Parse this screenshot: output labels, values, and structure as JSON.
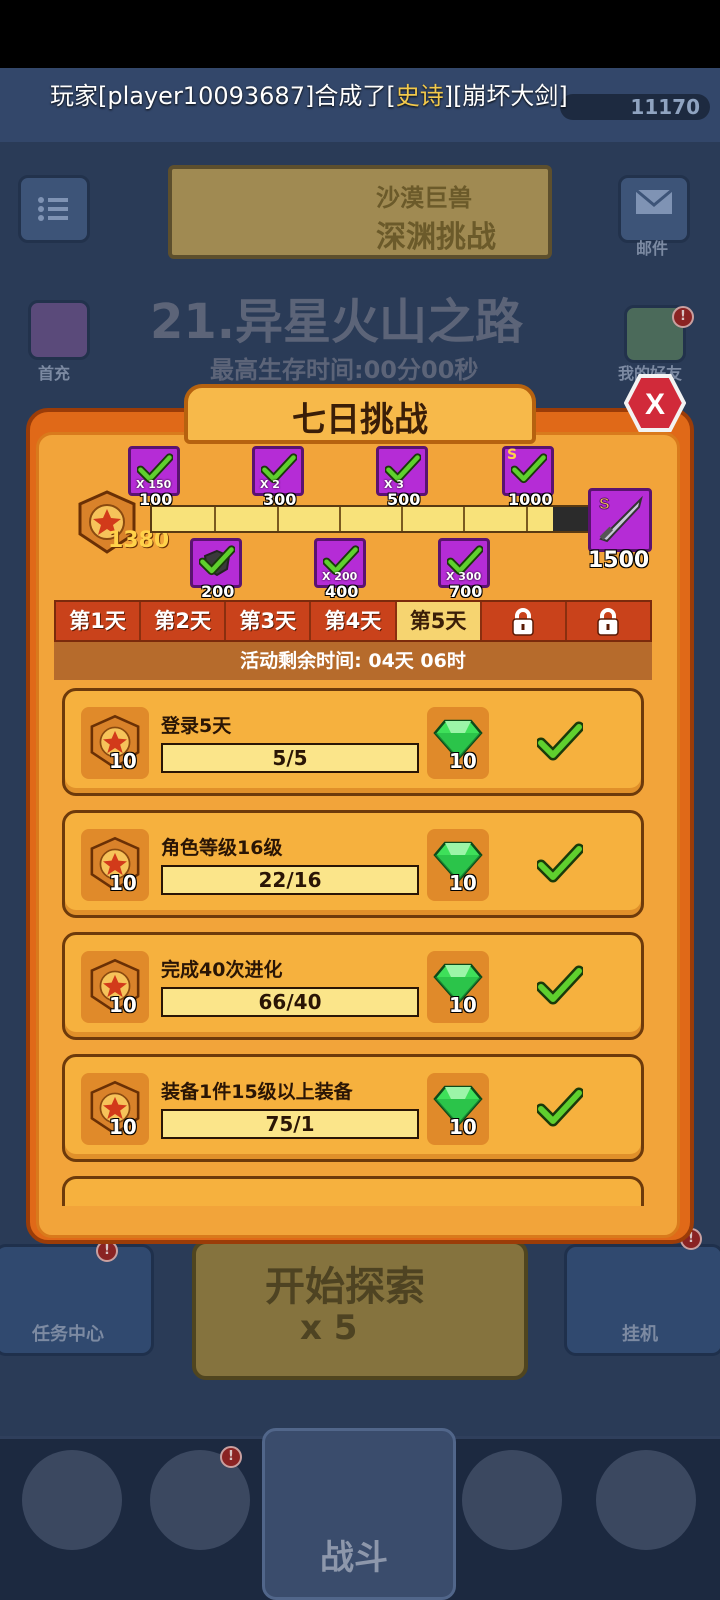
{
  "broadcast": {
    "prefix": "玩家[player10093687]合成了[",
    "rarity": "史诗",
    "suffix": "][崩坏大剑]"
  },
  "background": {
    "resource_value": "11170",
    "banner_line1": "沙漠巨兽",
    "banner_line2": "深渊挑战",
    "mail_label": "邮件",
    "first_charge_label": "首充",
    "friends_label": "我的好友",
    "stage_title": "21.异星火山之路",
    "stage_subtitle": "最高生存时间:00分00秒",
    "explore_label": "开始探索",
    "explore_cost": "x 5",
    "task_center_label": "任务中心",
    "idle_label": "挂机",
    "battle_label": "战斗",
    "alert_mark": "!"
  },
  "modal": {
    "title": "七日挑战",
    "close_label": "X",
    "points": 1380,
    "points_max": 1500,
    "milestones_top": [
      {
        "value": "100",
        "mult": "X 150",
        "reward": "gem",
        "claimed": true
      },
      {
        "value": "300",
        "mult": "X 2",
        "reward": "item",
        "claimed": true
      },
      {
        "value": "500",
        "mult": "X 3",
        "reward": "item",
        "claimed": true
      },
      {
        "value": "1000",
        "mult": "",
        "reward": "s-item",
        "claimed": true
      }
    ],
    "milestones_bottom": [
      {
        "value": "200",
        "mult": "",
        "reward": "shield",
        "claimed": true
      },
      {
        "value": "400",
        "mult": "X 200",
        "reward": "gem",
        "claimed": true
      },
      {
        "value": "700",
        "mult": "X 300",
        "reward": "gem",
        "claimed": true
      }
    ],
    "grand_reward": {
      "value": "1500",
      "reward": "s-sword",
      "claimed": false
    },
    "tabs": [
      {
        "label": "第1天",
        "locked": false,
        "active": false
      },
      {
        "label": "第2天",
        "locked": false,
        "active": false
      },
      {
        "label": "第3天",
        "locked": false,
        "active": false
      },
      {
        "label": "第4天",
        "locked": false,
        "active": false
      },
      {
        "label": "第5天",
        "locked": false,
        "active": true
      },
      {
        "label": "",
        "locked": true,
        "active": false
      },
      {
        "label": "",
        "locked": true,
        "active": false
      }
    ],
    "time_label": "活动剩余时间:",
    "time_value": "04天 06时",
    "tasks": [
      {
        "title": "登录5天",
        "progress": "5/5",
        "points": "10",
        "gems": "10",
        "done": true
      },
      {
        "title": "角色等级16级",
        "progress": "22/16",
        "points": "10",
        "gems": "10",
        "done": true
      },
      {
        "title": "完成40次进化",
        "progress": "66/40",
        "points": "10",
        "gems": "10",
        "done": true
      },
      {
        "title": "装备1件15级以上装备",
        "progress": "75/1",
        "points": "10",
        "gems": "10",
        "done": true
      }
    ]
  },
  "colors": {
    "accent_orange": "#e06918",
    "panel_gold": "#f6b13e",
    "epic_text": "#f2c94c",
    "milestone_purple": "#b52cd6",
    "check_green": "#5fd02e",
    "gem_green": "#3ee05a"
  }
}
